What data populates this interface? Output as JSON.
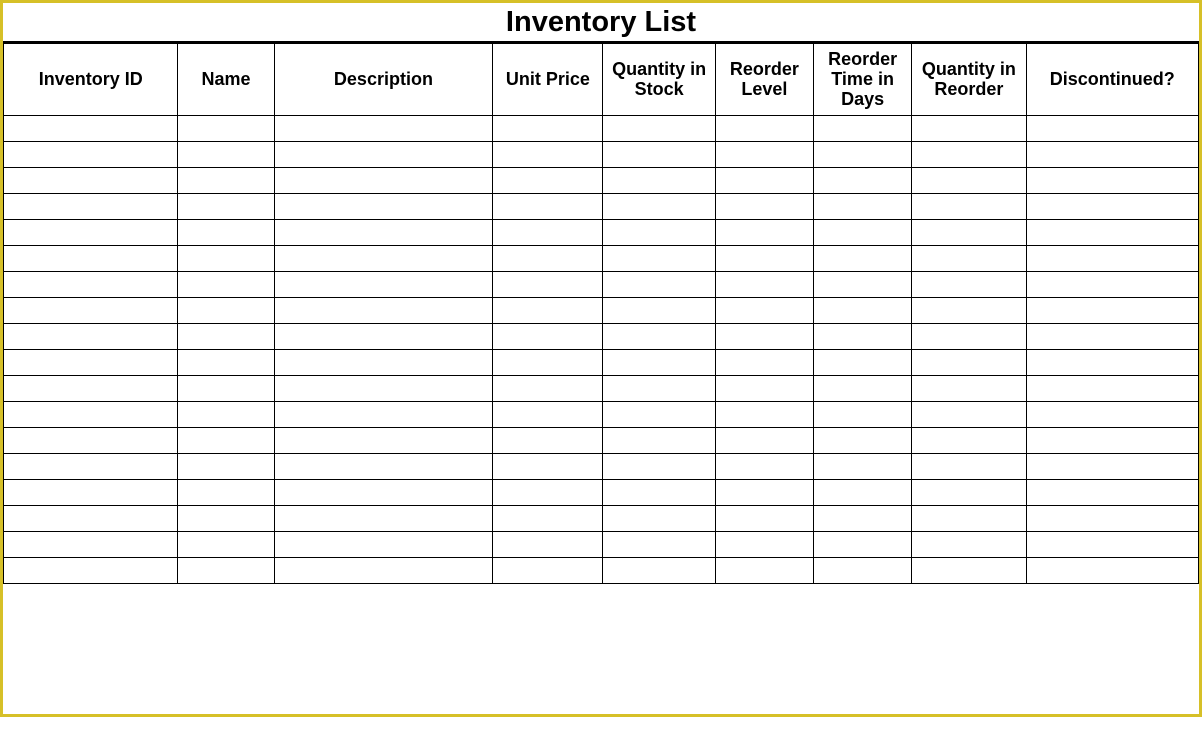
{
  "title": "Inventory List",
  "columns": [
    "Inventory ID",
    "Name",
    "Description",
    "Unit Price",
    "Quantity in Stock",
    "Reorder Level",
    "Reorder Time in Days",
    "Quantity in Reorder",
    "Discontinued?"
  ],
  "rows": [
    [
      "",
      "",
      "",
      "",
      "",
      "",
      "",
      "",
      ""
    ],
    [
      "",
      "",
      "",
      "",
      "",
      "",
      "",
      "",
      ""
    ],
    [
      "",
      "",
      "",
      "",
      "",
      "",
      "",
      "",
      ""
    ],
    [
      "",
      "",
      "",
      "",
      "",
      "",
      "",
      "",
      ""
    ],
    [
      "",
      "",
      "",
      "",
      "",
      "",
      "",
      "",
      ""
    ],
    [
      "",
      "",
      "",
      "",
      "",
      "",
      "",
      "",
      ""
    ],
    [
      "",
      "",
      "",
      "",
      "",
      "",
      "",
      "",
      ""
    ],
    [
      "",
      "",
      "",
      "",
      "",
      "",
      "",
      "",
      ""
    ],
    [
      "",
      "",
      "",
      "",
      "",
      "",
      "",
      "",
      ""
    ],
    [
      "",
      "",
      "",
      "",
      "",
      "",
      "",
      "",
      ""
    ],
    [
      "",
      "",
      "",
      "",
      "",
      "",
      "",
      "",
      ""
    ],
    [
      "",
      "",
      "",
      "",
      "",
      "",
      "",
      "",
      ""
    ],
    [
      "",
      "",
      "",
      "",
      "",
      "",
      "",
      "",
      ""
    ],
    [
      "",
      "",
      "",
      "",
      "",
      "",
      "",
      "",
      ""
    ],
    [
      "",
      "",
      "",
      "",
      "",
      "",
      "",
      "",
      ""
    ],
    [
      "",
      "",
      "",
      "",
      "",
      "",
      "",
      "",
      ""
    ],
    [
      "",
      "",
      "",
      "",
      "",
      "",
      "",
      "",
      ""
    ],
    [
      "",
      "",
      "",
      "",
      "",
      "",
      "",
      "",
      ""
    ]
  ],
  "faded_row_count": 5
}
